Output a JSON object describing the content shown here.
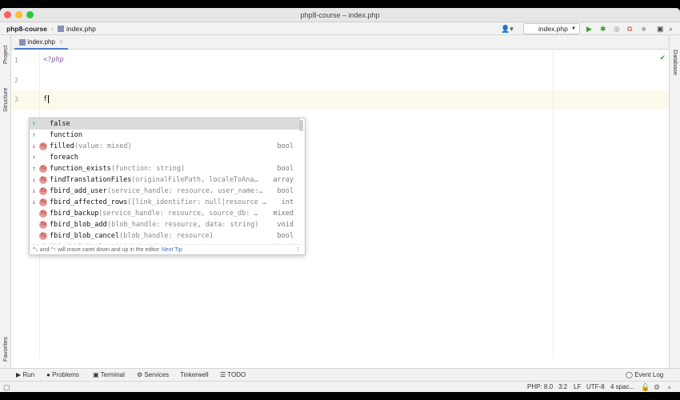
{
  "window": {
    "title": "php8-course – index.php"
  },
  "nav": {
    "project": "php8-course",
    "file": "index.php"
  },
  "toolbar": {
    "run_config": "index.php"
  },
  "tabs": [
    {
      "label": "index.php"
    }
  ],
  "left_strip": {
    "project": "Project",
    "structure": "Structure",
    "favorites": "Favorites"
  },
  "right_strip": {
    "database": "Database"
  },
  "editor": {
    "lines": [
      {
        "num": "1",
        "text": "<?php"
      },
      {
        "num": "2",
        "text": ""
      },
      {
        "num": "3",
        "text": "f"
      }
    ]
  },
  "completion": {
    "items": [
      {
        "arrow": "up",
        "fx": false,
        "name": "false",
        "args": "",
        "type": ""
      },
      {
        "arrow": "up",
        "fx": false,
        "name": "function",
        "args": "",
        "type": ""
      },
      {
        "arrow": "down",
        "fx": true,
        "name": "filled",
        "args": "(value: mixed)",
        "type": "bool"
      },
      {
        "arrow": "up",
        "fx": false,
        "name": "foreach",
        "args": "",
        "type": ""
      },
      {
        "arrow": "up",
        "fx": true,
        "name": "function_exists",
        "args": "(function: string)",
        "type": "bool"
      },
      {
        "arrow": "down",
        "fx": true,
        "name": "findTranslationFiles",
        "args": "(originalFilePath, localeToAna…",
        "type": "array"
      },
      {
        "arrow": "down",
        "fx": true,
        "name": "fbird_add_user",
        "args": "(service_handle: resource, user_name:…",
        "type": "bool"
      },
      {
        "arrow": "down",
        "fx": true,
        "name": "fbird_affected_rows",
        "args": "([link_identifier: null|resource …",
        "type": "int"
      },
      {
        "arrow": "",
        "fx": true,
        "name": "fbird_backup",
        "args": "(service_handle: resource, source_db: …",
        "type": "mixed"
      },
      {
        "arrow": "",
        "fx": true,
        "name": "fbird_blob_add",
        "args": "(blob_handle: resource, data: string)",
        "type": "void"
      },
      {
        "arrow": "",
        "fx": true,
        "name": "fbird_blob_cancel",
        "args": "(blob_handle: resource)",
        "type": "bool"
      },
      {
        "arrow": "",
        "fx": true,
        "name": "fbird_blob_close",
        "args": "(blob_handle: resource)",
        "type": "mixed"
      }
    ],
    "hint": "^↓ and ^↑ will move caret down and up in the editor",
    "next_tip": "Next Tip"
  },
  "tool_windows": {
    "run": "Run",
    "problems": "Problems",
    "terminal": "Terminal",
    "services": "Services",
    "tinkerwell": "Tinkerwell",
    "todo": "TODO",
    "event_log": "Event Log"
  },
  "status": {
    "php": "PHP: 8.0",
    "pos": "3:2",
    "eol": "LF",
    "encoding": "UTF-8",
    "indent": "4 spac..."
  }
}
